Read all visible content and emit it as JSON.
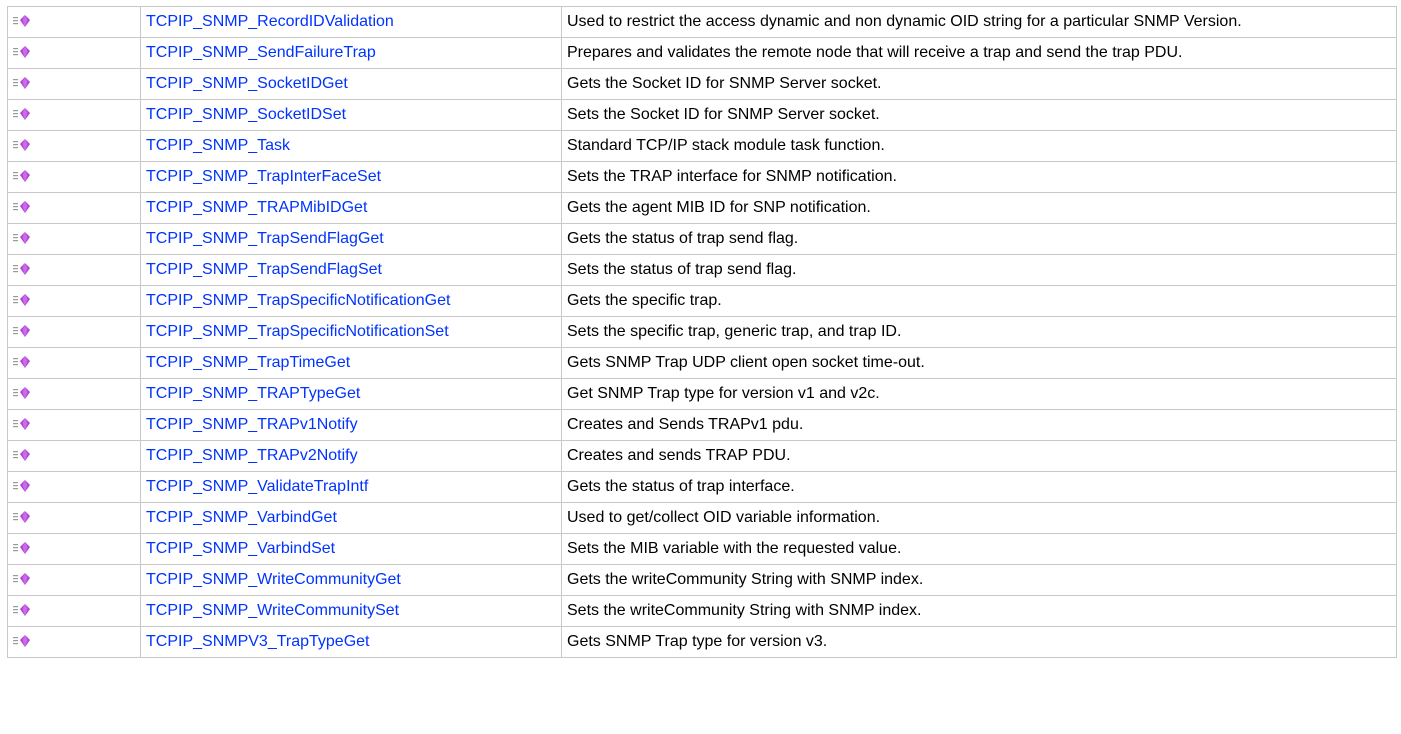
{
  "colors": {
    "link": "#0033ff",
    "border": "#c8c8c8",
    "icon_gem": "#b23fd9",
    "icon_lines": "#9a9a9a"
  },
  "row_icon": "public-method-icon",
  "rows": [
    {
      "name": "TCPIP_SNMP_RecordIDValidation",
      "description": "Used to restrict the access dynamic and non dynamic OID string for a particular SNMP Version."
    },
    {
      "name": "TCPIP_SNMP_SendFailureTrap",
      "description": "Prepares and validates the remote node that will receive a trap and send the trap PDU."
    },
    {
      "name": "TCPIP_SNMP_SocketIDGet",
      "description": "Gets the Socket ID for SNMP Server socket."
    },
    {
      "name": "TCPIP_SNMP_SocketIDSet",
      "description": "Sets the Socket ID for SNMP Server socket."
    },
    {
      "name": "TCPIP_SNMP_Task",
      "description": "Standard TCP/IP stack module task function."
    },
    {
      "name": "TCPIP_SNMP_TrapInterFaceSet",
      "description": "Sets the TRAP interface for SNMP notification."
    },
    {
      "name": "TCPIP_SNMP_TRAPMibIDGet",
      "description": "Gets the agent MIB ID for SNP notification."
    },
    {
      "name": "TCPIP_SNMP_TrapSendFlagGet",
      "description": "Gets the status of trap send flag."
    },
    {
      "name": "TCPIP_SNMP_TrapSendFlagSet",
      "description": "Sets the status of trap send flag."
    },
    {
      "name": "TCPIP_SNMP_TrapSpecificNotificationGet",
      "description": "Gets the specific trap."
    },
    {
      "name": "TCPIP_SNMP_TrapSpecificNotificationSet",
      "description": "Sets the specific trap, generic trap, and trap ID."
    },
    {
      "name": "TCPIP_SNMP_TrapTimeGet",
      "description": "Gets SNMP Trap UDP client open socket time-out."
    },
    {
      "name": "TCPIP_SNMP_TRAPTypeGet",
      "description": "Get SNMP Trap type for version v1 and v2c."
    },
    {
      "name": "TCPIP_SNMP_TRAPv1Notify",
      "description": "Creates and Sends TRAPv1 pdu."
    },
    {
      "name": "TCPIP_SNMP_TRAPv2Notify",
      "description": "Creates and sends TRAP PDU."
    },
    {
      "name": "TCPIP_SNMP_ValidateTrapIntf",
      "description": "Gets the status of trap interface."
    },
    {
      "name": "TCPIP_SNMP_VarbindGet",
      "description": "Used to get/collect OID variable information."
    },
    {
      "name": "TCPIP_SNMP_VarbindSet",
      "description": "Sets the MIB variable with the requested value."
    },
    {
      "name": "TCPIP_SNMP_WriteCommunityGet",
      "description": "Gets the writeCommunity String with SNMP index."
    },
    {
      "name": "TCPIP_SNMP_WriteCommunitySet",
      "description": "Sets the writeCommunity String with SNMP index."
    },
    {
      "name": "TCPIP_SNMPV3_TrapTypeGet",
      "description": "Gets SNMP Trap type for version v3."
    }
  ]
}
